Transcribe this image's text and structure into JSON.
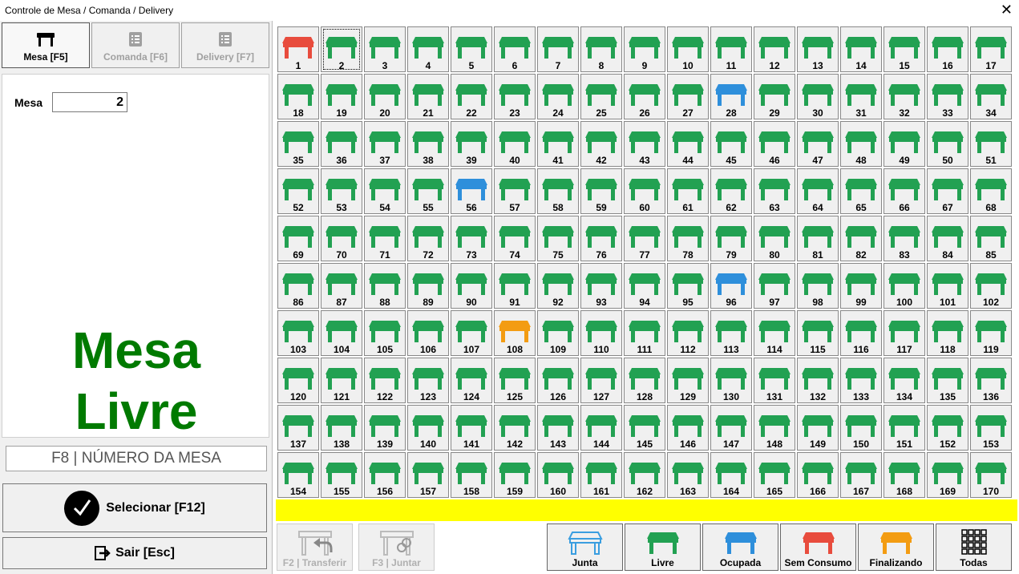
{
  "window": {
    "title": "Controle de Mesa / Comanda / Delivery",
    "close_label": "✕"
  },
  "tabs": [
    {
      "label": "Mesa [F5]",
      "icon": "table-icon",
      "active": true
    },
    {
      "label": "Comanda [F6]",
      "icon": "list-icon",
      "active": false
    },
    {
      "label": "Delivery [F7]",
      "icon": "list-icon",
      "active": false
    }
  ],
  "form": {
    "mesa_label": "Mesa",
    "mesa_value": "2"
  },
  "status": {
    "line1": "Mesa",
    "line2": "Livre",
    "color": "#007a00"
  },
  "number_field": {
    "placeholder": "F8 | NÚMERO DA MESA"
  },
  "buttons": {
    "select_label": "Selecionar [F12]",
    "exit_label": "Sair [Esc]"
  },
  "tables": {
    "count": 170,
    "selected": 2,
    "default_status": "livre",
    "status_overrides": {
      "1": "sem_consumo",
      "28": "ocupada",
      "56": "ocupada",
      "96": "ocupada",
      "108": "finalizando"
    }
  },
  "status_colors": {
    "livre": "#22a152",
    "ocupada": "#2e8fdb",
    "sem_consumo": "#e84c3d",
    "finalizando": "#f39c12",
    "junta": "#3a9ee0"
  },
  "actions": [
    {
      "label": "F2 | Transferir",
      "icon": "transfer-icon",
      "enabled": false
    },
    {
      "label": "F3 | Juntar",
      "icon": "join-icon",
      "enabled": false
    }
  ],
  "filters": [
    {
      "label": "Junta",
      "status": "junta",
      "icon": "table-outline-icon"
    },
    {
      "label": "Livre",
      "status": "livre",
      "icon": "table-icon"
    },
    {
      "label": "Ocupada",
      "status": "ocupada",
      "icon": "table-icon"
    },
    {
      "label": "Sem Consumo",
      "status": "sem_consumo",
      "icon": "table-icon"
    },
    {
      "label": "Finalizando",
      "status": "finalizando",
      "icon": "table-icon"
    },
    {
      "label": "Todas",
      "status": "todas",
      "icon": "grid-icon"
    }
  ]
}
